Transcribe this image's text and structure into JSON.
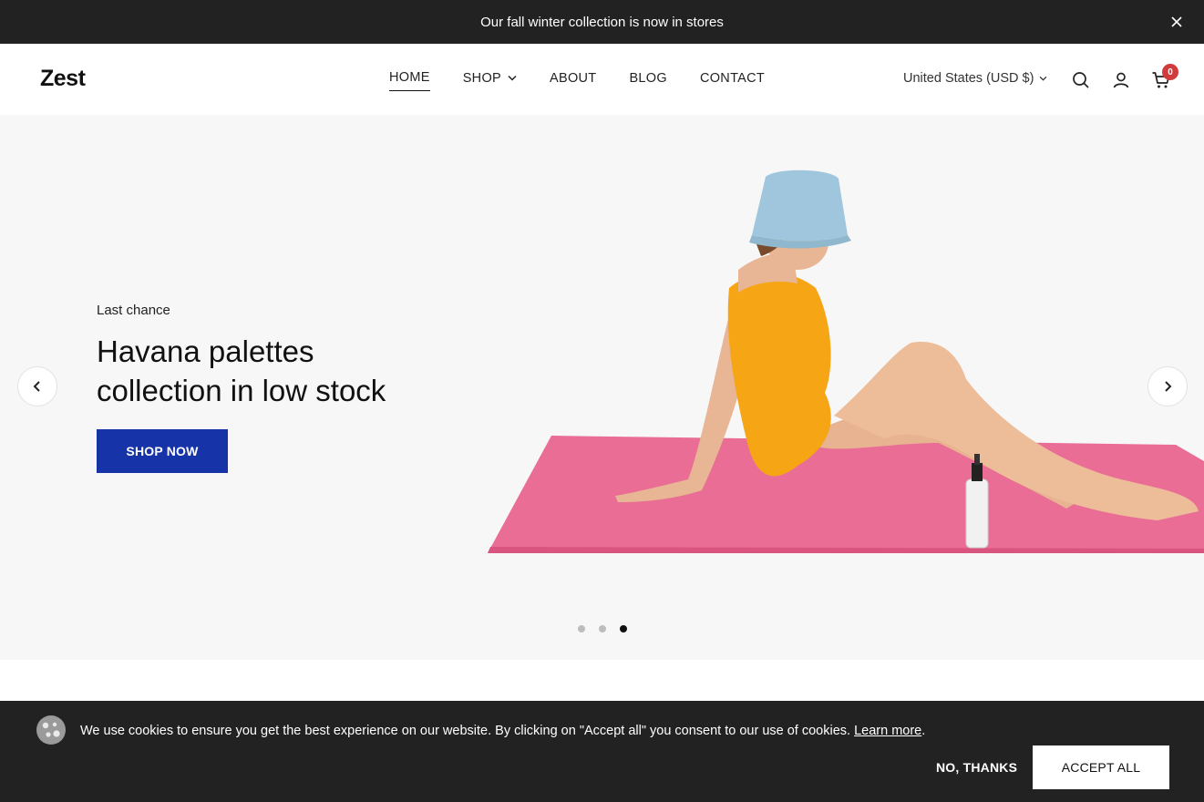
{
  "announcement": {
    "text": "Our fall winter collection is now in stores"
  },
  "header": {
    "logo": "Zest",
    "nav": [
      {
        "label": "HOME",
        "active": true
      },
      {
        "label": "SHOP",
        "has_dropdown": true
      },
      {
        "label": "ABOUT"
      },
      {
        "label": "BLOG"
      },
      {
        "label": "CONTACT"
      }
    ],
    "currency": "United States (USD $)",
    "cart_count": "0"
  },
  "hero": {
    "eyebrow": "Last chance",
    "title": "Havana palettes collection in low stock",
    "button": "SHOP NOW",
    "slides": 3,
    "active_slide": 3
  },
  "cookie": {
    "text": "We use cookies to ensure you get the best experience on our website. By clicking on \"Accept all\" you consent to our use of cookies.",
    "link": "Learn more",
    "period": ".",
    "decline": "NO, THANKS",
    "accept": "ACCEPT ALL"
  },
  "colors": {
    "announcement_bg": "#222222",
    "primary_button": "#1634a8",
    "badge": "#d23b3b",
    "hero_bg": "#f7f7f7"
  }
}
